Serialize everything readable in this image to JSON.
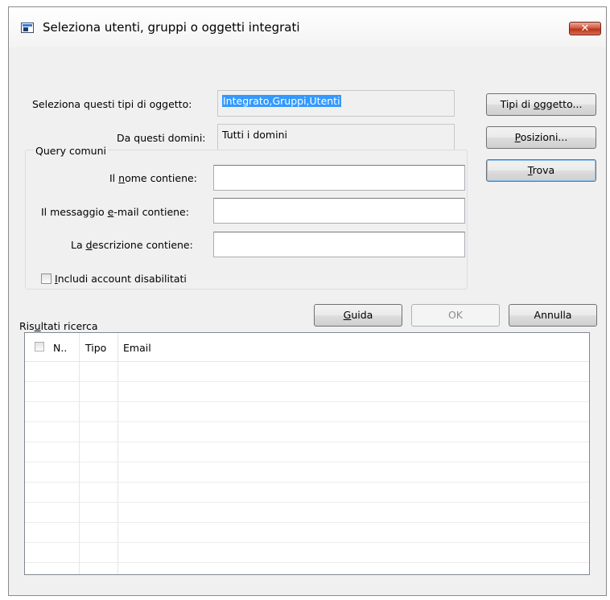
{
  "window": {
    "title": "Seleziona utenti, gruppi o oggetti integrati",
    "close_symbol": "✕"
  },
  "object_types": {
    "label": "Seleziona questi tipi di oggetto:",
    "value": "Integrato,Gruppi,Utenti",
    "button_pre": "Tipi di ",
    "button_key": "o",
    "button_post": "ggetto..."
  },
  "domains": {
    "label": "Da questi domini:",
    "value": "Tutti i domini",
    "button_key": "P",
    "button_post": "osizioni..."
  },
  "common_queries": {
    "legend": "Query comuni",
    "name_pre": "Il ",
    "name_key": "n",
    "name_post": "ome contiene:",
    "email_pre": "Il messaggio ",
    "email_key": "e",
    "email_post": "-mail contiene:",
    "desc_pre": "La ",
    "desc_key": "d",
    "desc_post": "escrizione contiene:",
    "checkbox_key": "I",
    "checkbox_post": "ncludi account disabilitati",
    "name_value": "",
    "email_value": "",
    "desc_value": ""
  },
  "buttons": {
    "find_key": "T",
    "find_post": "rova",
    "help_key": "G",
    "help_post": "uida",
    "ok": "OK",
    "cancel": "Annulla"
  },
  "results": {
    "label_pre": "Ris",
    "label_key": "u",
    "label_post": "ltati ricerca",
    "columns": [
      "N..",
      "Tipo",
      "Email"
    ],
    "rows": []
  }
}
